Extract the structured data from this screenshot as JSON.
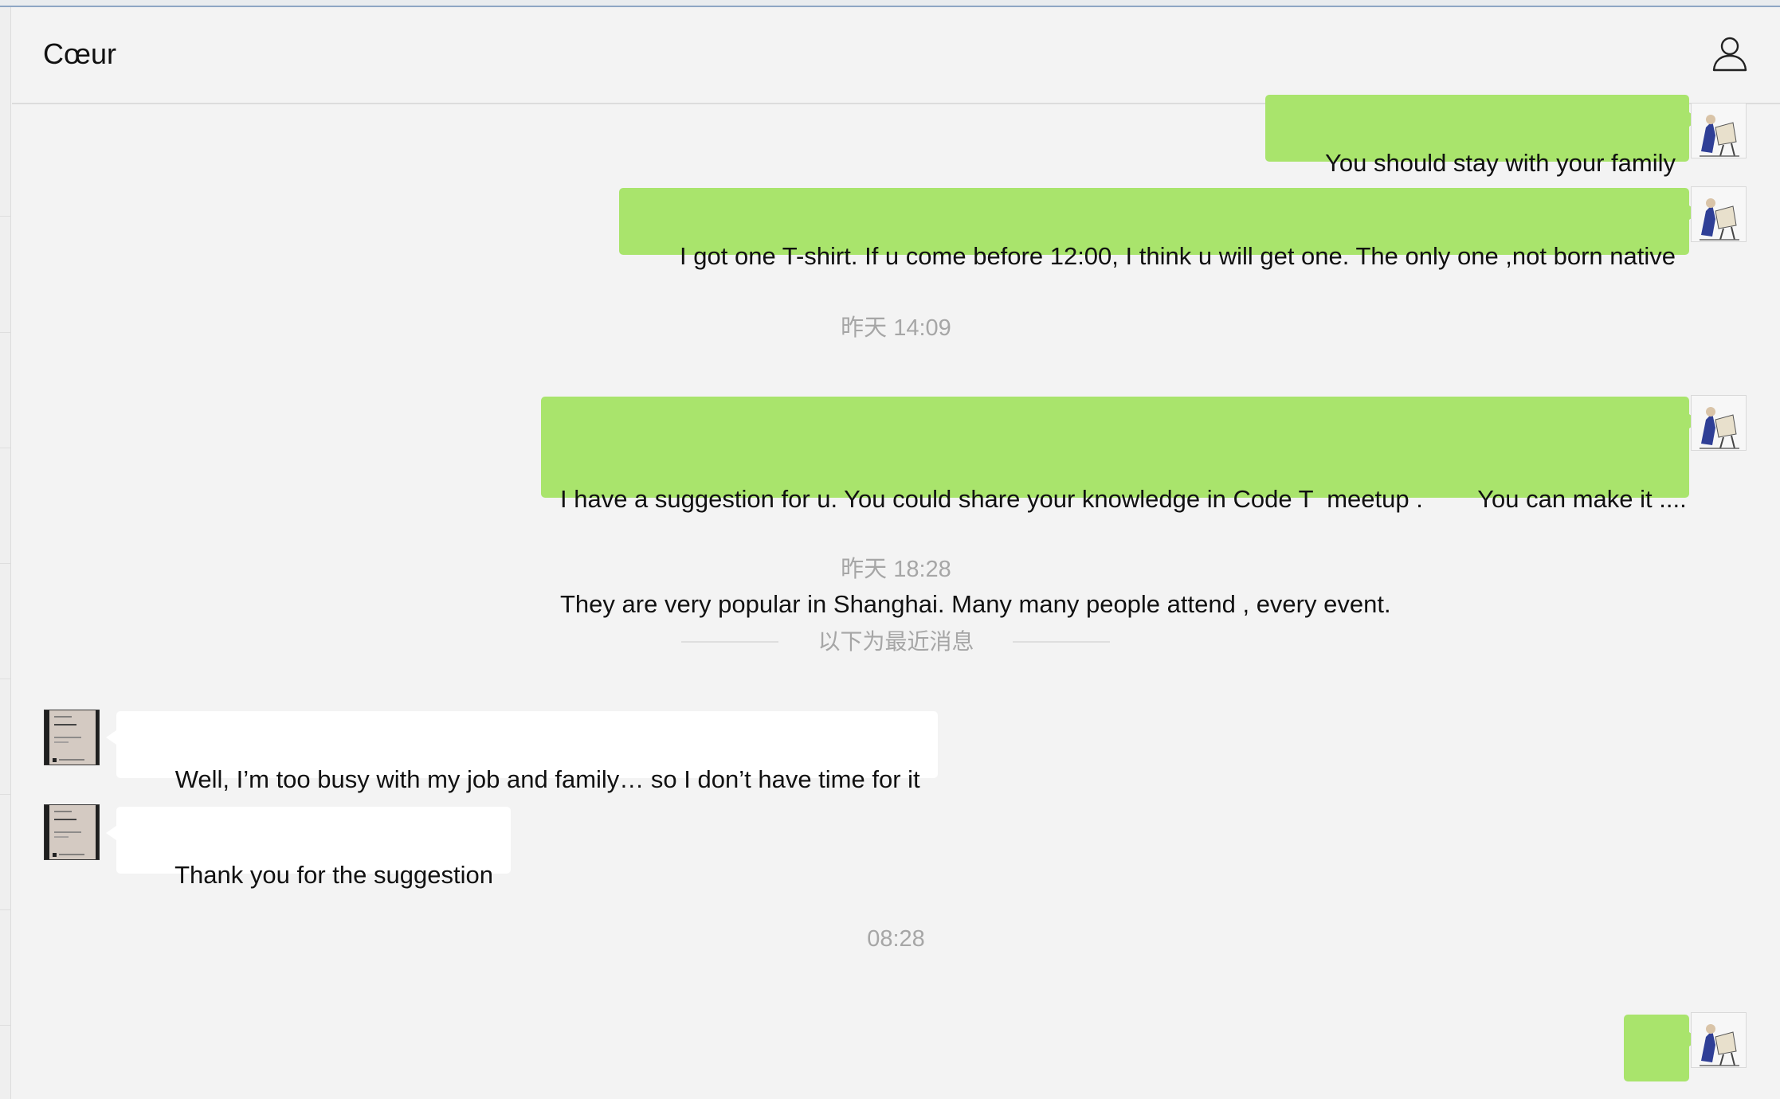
{
  "header": {
    "title": "Cœur",
    "profile_icon": "person-icon"
  },
  "messages": [
    {
      "direction": "out",
      "text": "You should stay with your family"
    },
    {
      "direction": "out",
      "text": "I got one T-shirt. If u come before 12:00, I think u will get one. The only one ,not born native"
    },
    {
      "type": "timestamp",
      "text": "昨天 14:09"
    },
    {
      "direction": "out",
      "line1": "I have a suggestion for u. You could share your knowledge in Code T  meetup .        You can make it ....",
      "line2": "They are very popular in Shanghai. Many many people attend , every event."
    },
    {
      "type": "timestamp",
      "text": "昨天 18:28"
    },
    {
      "type": "divider",
      "text": "以下为最近消息"
    },
    {
      "direction": "in",
      "text": "Well, I’m too busy with my job and family… so I don’t have time for it"
    },
    {
      "direction": "in",
      "text": "Thank you for the suggestion"
    },
    {
      "type": "timestamp",
      "text": "08:28"
    },
    {
      "direction": "out",
      "text": "👌🏻",
      "icon": "ok-hand-emoji"
    }
  ],
  "colors": {
    "outgoing_bubble": "#a9e46c",
    "incoming_bubble": "#ffffff",
    "background": "#f3f3f3",
    "timestamp_text": "#a6a6a6"
  }
}
